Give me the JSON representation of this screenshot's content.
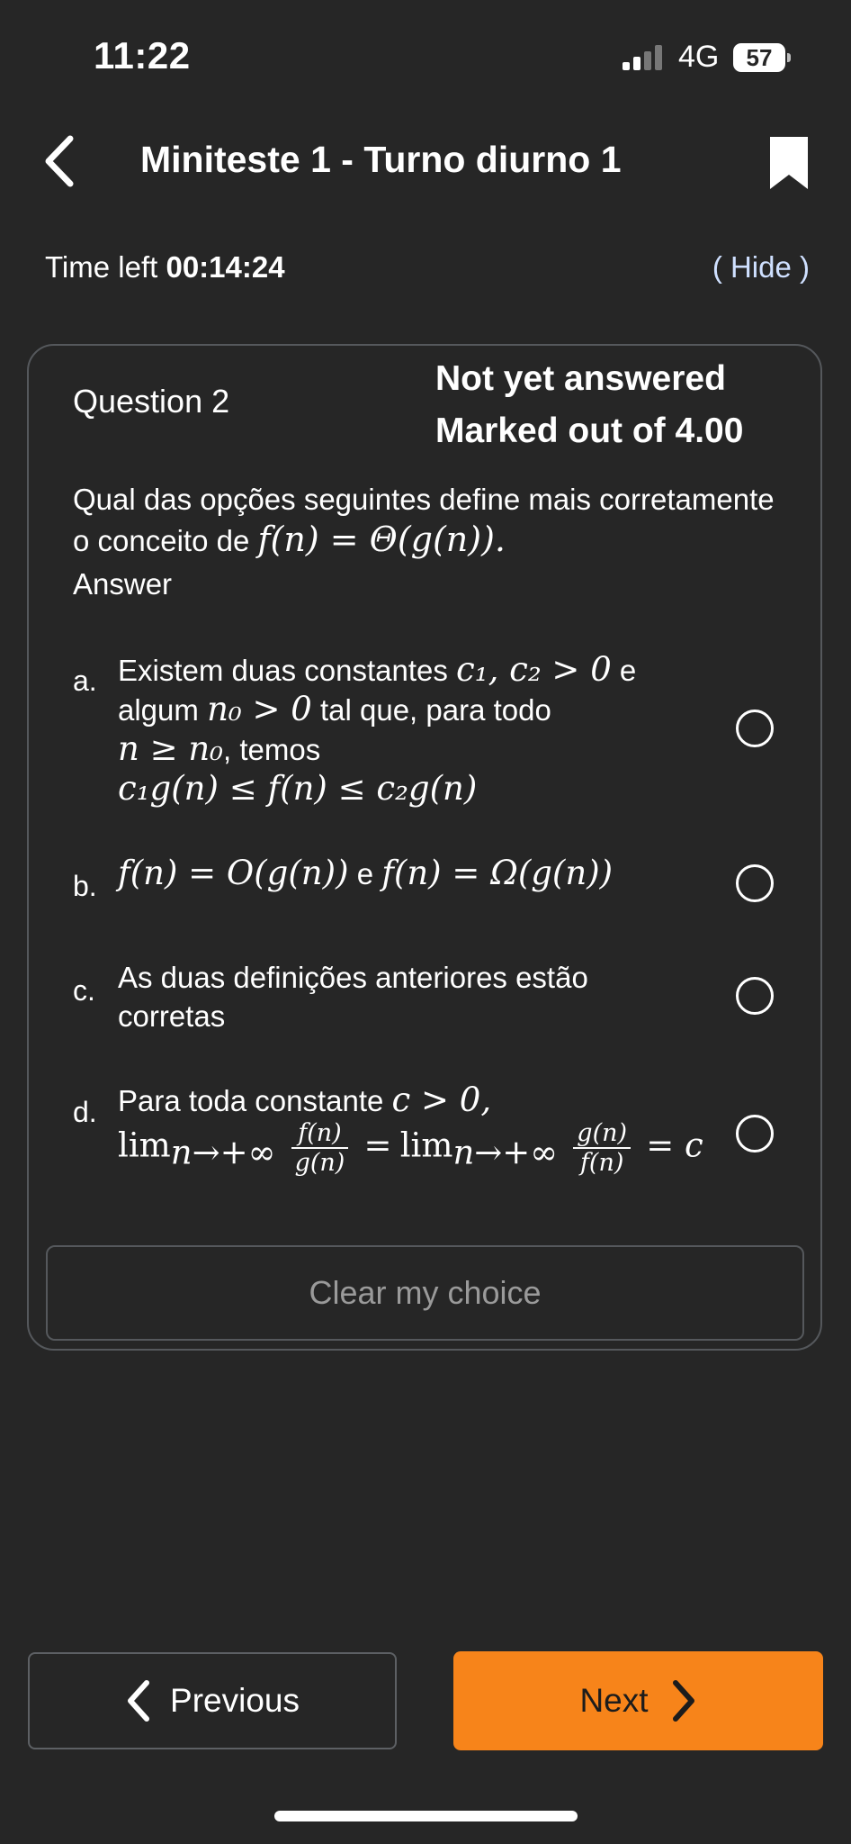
{
  "status_bar": {
    "time": "11:22",
    "network": "4G",
    "battery": "57",
    "icons": [
      "signal-icon",
      "battery-icon"
    ]
  },
  "header": {
    "title": "Miniteste 1 - Turno diurno 1",
    "icons": [
      "chevron-left-icon",
      "bookmark-icon"
    ]
  },
  "timer": {
    "label": "Time left",
    "value": "00:14:24",
    "hide_label": "( Hide )"
  },
  "question": {
    "number_label": "Question 2",
    "state": "Not yet answered",
    "marks": "Marked out of 4.00",
    "text": "Qual das opções seguintes define mais corretamente o conceito de",
    "text_math": "f(n) = Θ(g(n)).",
    "answer_label": "Answer",
    "options": [
      {
        "letter": "a.",
        "t1": "Existem duas constantes",
        "m1": "c₁, c₂ > 0",
        "t2": "e algum",
        "m2": "n₀ > 0",
        "t3": "tal que, para todo",
        "m3": "n ≥ n₀",
        "t4": ", temos",
        "m4": "c₁g(n) ≤ f(n) ≤ c₂g(n)"
      },
      {
        "letter": "b.",
        "m1": "f(n) = O(g(n))",
        "t1": "e",
        "m2": "f(n) = Ω(g(n))"
      },
      {
        "letter": "c.",
        "t1": "As duas definições anteriores estão corretas"
      },
      {
        "letter": "d.",
        "t1": "Para toda constante",
        "m1": "c > 0,",
        "lim": "lim",
        "lim_sub": "n→+∞",
        "frac1_num": "f(n)",
        "frac1_den": "g(n)",
        "eq": "=",
        "frac2_num": "g(n)",
        "frac2_den": "f(n)",
        "tail": "= c"
      }
    ],
    "selected": null,
    "clear_label": "Clear my choice"
  },
  "navigation": {
    "previous_label": "Previous",
    "next_label": "Next",
    "icons": [
      "chevron-left-icon",
      "chevron-right-icon"
    ]
  },
  "colors": {
    "background": "#262626",
    "accent": "#f7841a",
    "border": "#55585c"
  }
}
